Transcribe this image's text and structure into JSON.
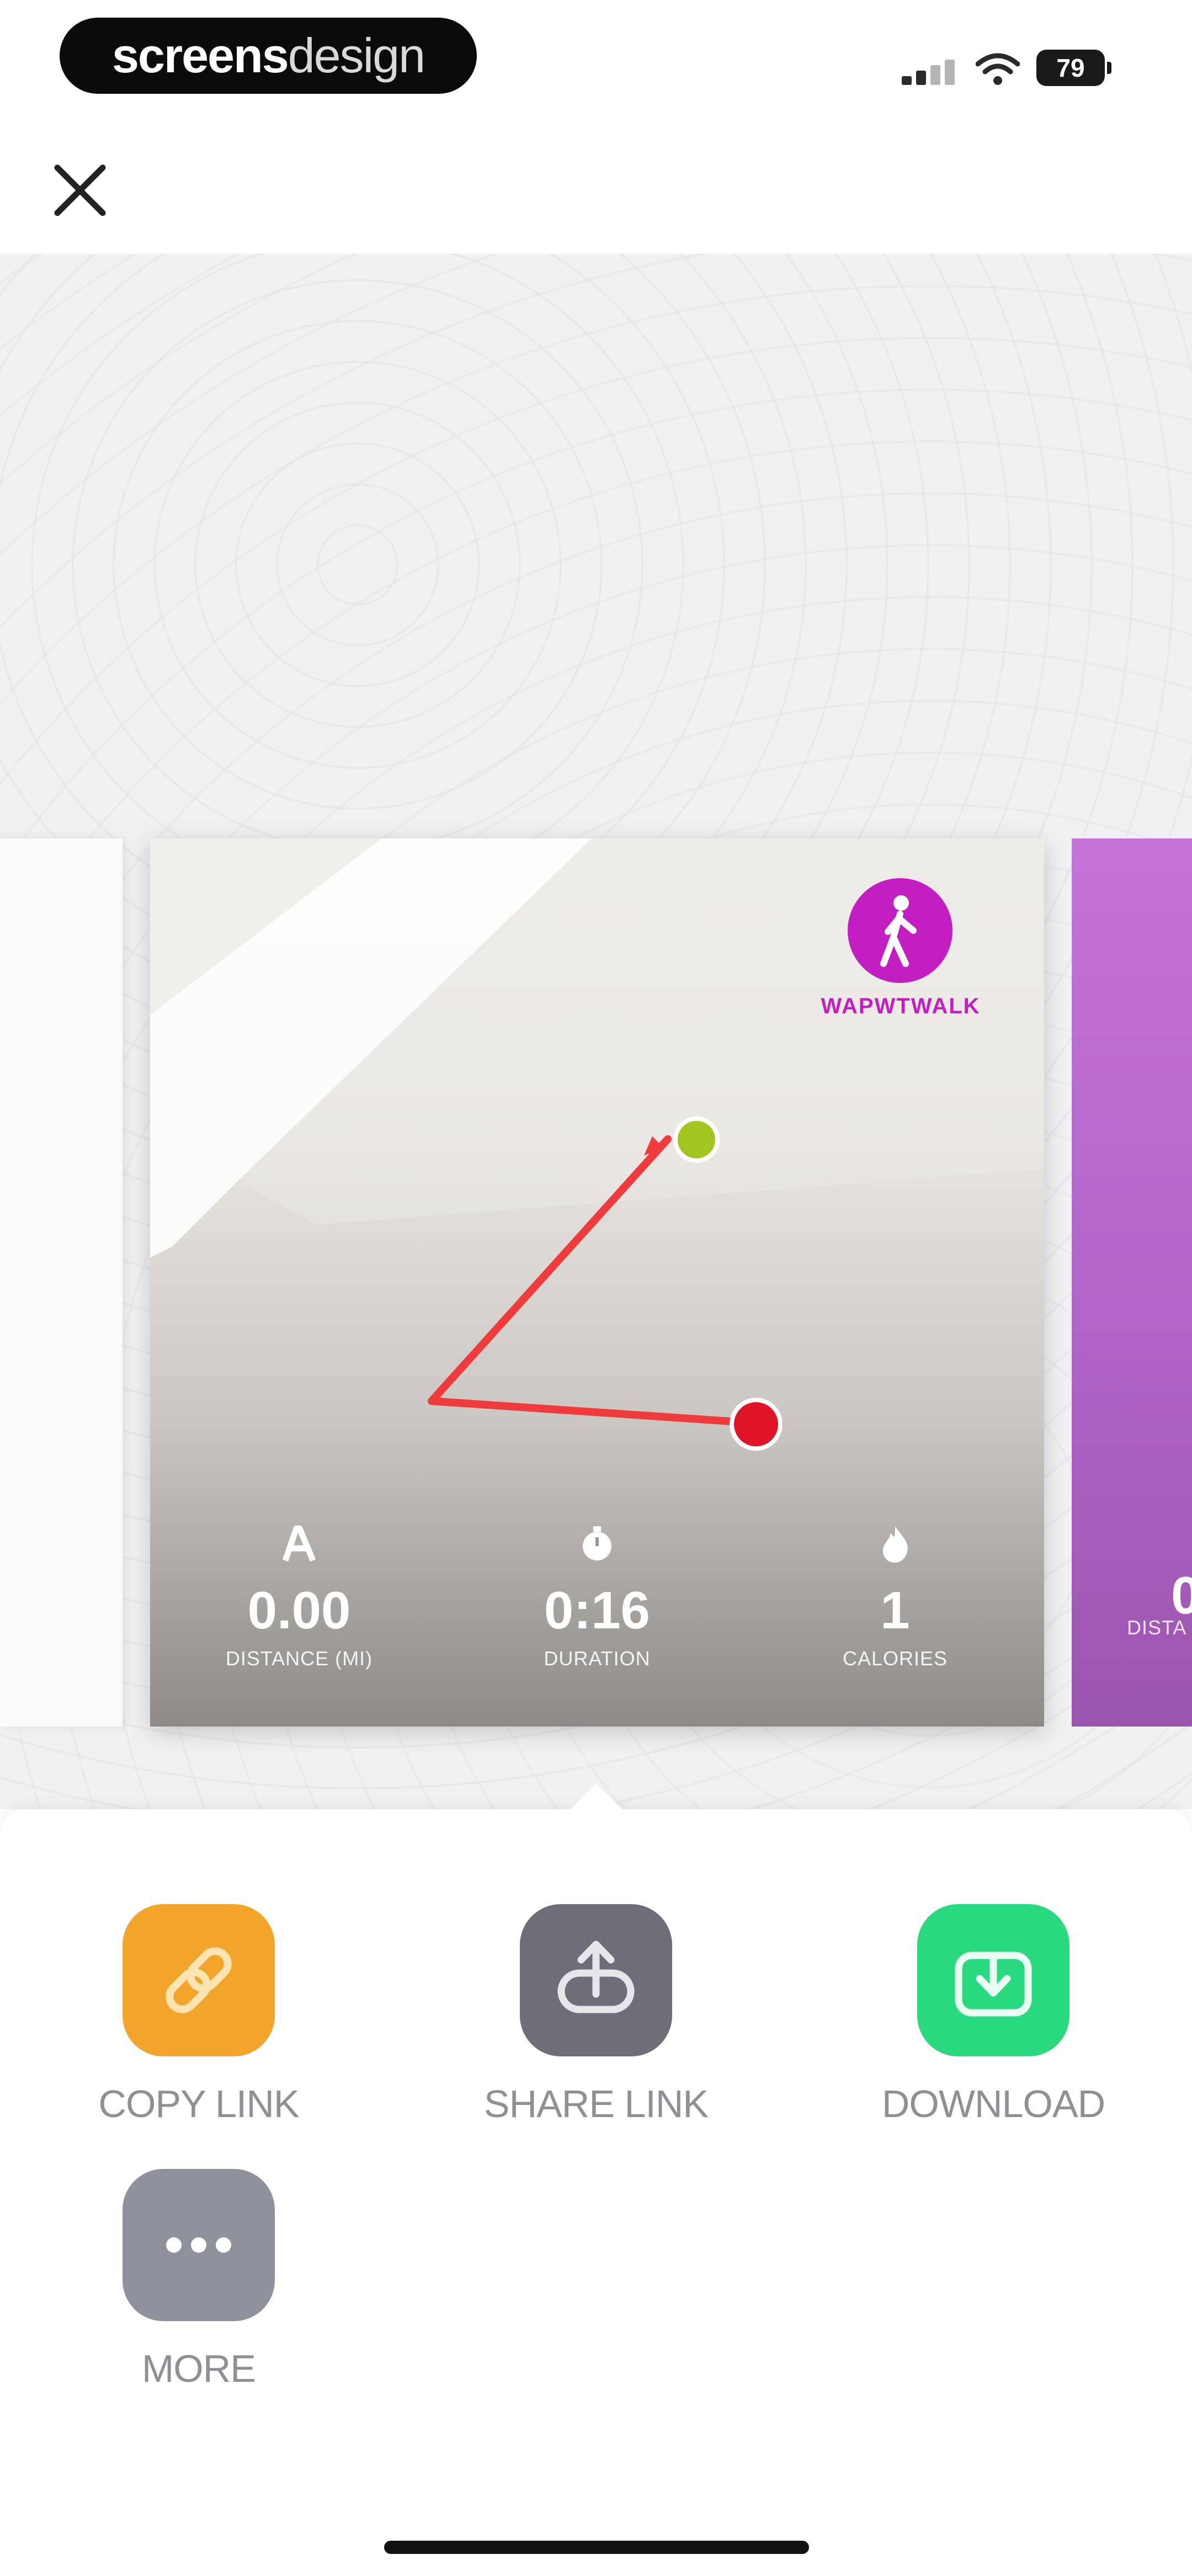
{
  "status_bar": {
    "brand_part1": "screens",
    "brand_part2": "design",
    "battery": "79"
  },
  "preview": {
    "brand_name": "WAPWTWALK",
    "stats": [
      {
        "icon": "distance-icon",
        "value": "0.00",
        "label": "DISTANCE (MI)"
      },
      {
        "icon": "timer-icon",
        "value": "0:16",
        "label": "DURATION"
      },
      {
        "icon": "flame-icon",
        "value": "1",
        "label": "CALORIES"
      }
    ],
    "next_card": {
      "value": "0",
      "label": "DISTA"
    },
    "route": {
      "start_color": "#a2c51f",
      "end_color": "#e01427",
      "line_color": "#ef3b3b"
    }
  },
  "share_sheet": {
    "actions": [
      {
        "label": "COPY LINK",
        "icon": "link-icon",
        "color": "#f2a52a"
      },
      {
        "label": "SHARE LINK",
        "icon": "share-icon",
        "color": "#6d6e78"
      },
      {
        "label": "DOWNLOAD",
        "icon": "download-icon",
        "color": "#28d980"
      },
      {
        "label": "MORE",
        "icon": "more-icon",
        "color": "#8f929c"
      }
    ]
  }
}
